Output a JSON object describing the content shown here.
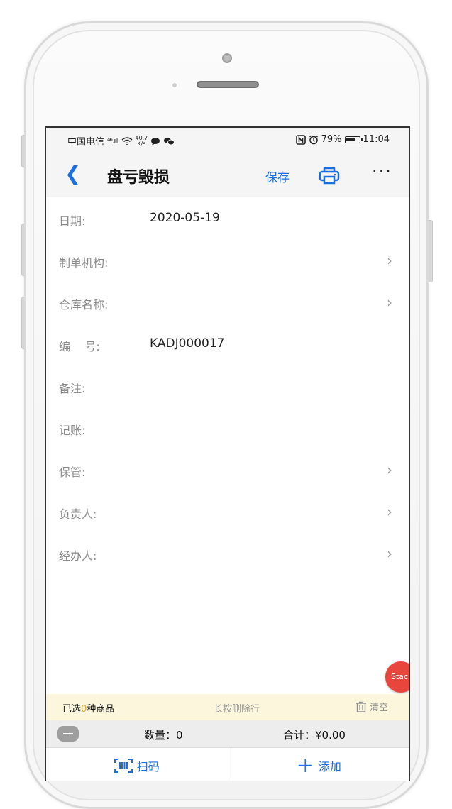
{
  "statusbar": {
    "carrier": "中国电信",
    "network": "⁴⁶.ıll",
    "speed_value": "40.7",
    "speed_unit": "K/s",
    "battery": "79%",
    "time": "11:04"
  },
  "navbar": {
    "back_glyph": "❮",
    "title": "盘亏毁损",
    "save_label": "保存",
    "more_glyph": "···"
  },
  "form": {
    "fields": [
      {
        "label": "日期:",
        "value": "2020-05-19",
        "has_chevron": false
      },
      {
        "label": "制单机构:",
        "value": "",
        "has_chevron": true
      },
      {
        "label": "仓库名称:",
        "value": "",
        "has_chevron": true
      },
      {
        "label": "编    号:",
        "value": "KADJ000017",
        "has_chevron": false
      },
      {
        "label": "备注:",
        "value": "",
        "has_chevron": false
      },
      {
        "label": "记账:",
        "value": "",
        "has_chevron": false
      },
      {
        "label": "保管:",
        "value": "",
        "has_chevron": true
      },
      {
        "label": "负责人:",
        "value": "",
        "has_chevron": true
      },
      {
        "label": "经办人:",
        "value": "",
        "has_chevron": true
      }
    ],
    "chevron_glyph": "›"
  },
  "floating": {
    "stac_label": "Stac"
  },
  "selection": {
    "prefix": "已选",
    "count": "0",
    "suffix": "种商品",
    "hint": "长按删除行",
    "clear_label": "清空"
  },
  "totals": {
    "qty_text": "数量：0",
    "sum_text": "合计：¥0.00"
  },
  "actions": {
    "scan_label": "扫码",
    "add_label": "添加",
    "plus_glyph": "+"
  },
  "colors": {
    "accent": "#1b6fe0",
    "selection_bg": "#fcf7dc",
    "count_color": "#f1a124",
    "stac_bg": "#e8453c"
  }
}
